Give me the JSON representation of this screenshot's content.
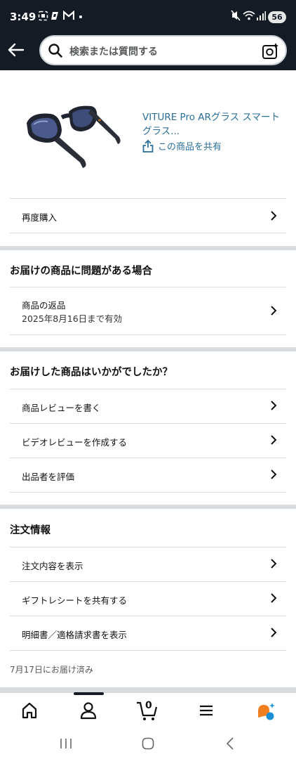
{
  "status_bar": {
    "time": "3:49",
    "battery": "56"
  },
  "header": {
    "search_placeholder": "検索または質問する"
  },
  "product": {
    "title": "VITURE Pro ARグラス スマートグラス...",
    "share_label": "この商品を共有"
  },
  "rebuy": {
    "label": "再度購入"
  },
  "problem_section": {
    "title": "お届けの商品に問題がある場合",
    "return_label": "商品の返品",
    "return_sub": "2025年8月16日まで有効"
  },
  "review_section": {
    "title": "お届けした商品はいかがでしたか？",
    "items": [
      "商品レビューを書く",
      "ビデオレビューを作成する",
      "出品者を評価"
    ]
  },
  "order_section": {
    "title": "注文情報",
    "items": [
      "注文内容を表示",
      "ギフトレシートを共有する",
      "明細書／適格請求書を表示"
    ],
    "delivered": "7月17日にお届け済み"
  },
  "bottom_nav": {
    "cart_count": "0",
    "items": [
      "home-icon",
      "account-icon",
      "cart-icon",
      "menu-icon",
      "assistant-icon"
    ]
  },
  "colors": {
    "header_bg": "#141b24",
    "link": "#2a6f9b",
    "divider": "#d9dcdf",
    "assistant_orange": "#f0801f",
    "assistant_blue": "#1a8fd6"
  }
}
